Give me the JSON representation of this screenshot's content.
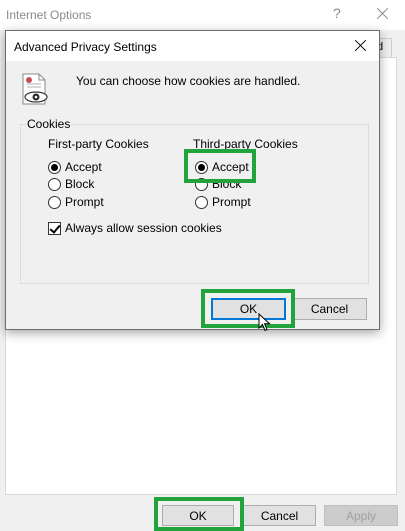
{
  "background_window": {
    "title": "Internet Options",
    "help_glyph": "?",
    "tab_partial_label": "d",
    "buttons": {
      "ok": "OK",
      "cancel": "Cancel",
      "apply": "Apply"
    }
  },
  "dialog": {
    "title": "Advanced Privacy Settings",
    "intro_text": "You can choose how cookies are handled.",
    "group_label": "Cookies",
    "first_party": {
      "heading": "First-party Cookies",
      "options": [
        "Accept",
        "Block",
        "Prompt"
      ],
      "selected": "Accept"
    },
    "third_party": {
      "heading": "Third-party Cookies",
      "options": [
        "Accept",
        "Block",
        "Prompt"
      ],
      "selected": "Accept"
    },
    "session_checkbox": {
      "label": "Always allow session cookies",
      "checked": true
    },
    "buttons": {
      "ok": "OK",
      "cancel": "Cancel"
    }
  },
  "colors": {
    "highlight": "#22a33b",
    "focus_border": "#0078d7"
  },
  "icons": [
    "document-eye-icon",
    "close-icon",
    "cursor-icon"
  ]
}
